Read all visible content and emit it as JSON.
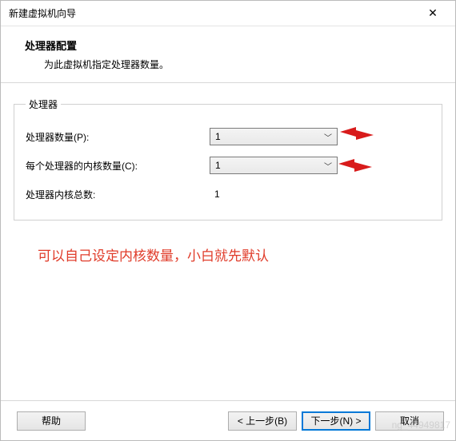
{
  "window": {
    "title": "新建虚拟机向导"
  },
  "header": {
    "heading": "处理器配置",
    "subheading": "为此虚拟机指定处理器数量。"
  },
  "group": {
    "legend": "处理器",
    "rows": {
      "procCount": {
        "label": "处理器数量(P):",
        "value": "1"
      },
      "coresPer": {
        "label": "每个处理器的内核数量(C):",
        "value": "1"
      },
      "total": {
        "label": "处理器内核总数:",
        "value": "1"
      }
    }
  },
  "annotation": "可以自己设定内核数量，小白就先默认",
  "buttons": {
    "help": "帮助",
    "back": "< 上一步(B)",
    "next": "下一步(N) >",
    "cancel": "取消"
  },
  "watermark": "ng_44949817"
}
